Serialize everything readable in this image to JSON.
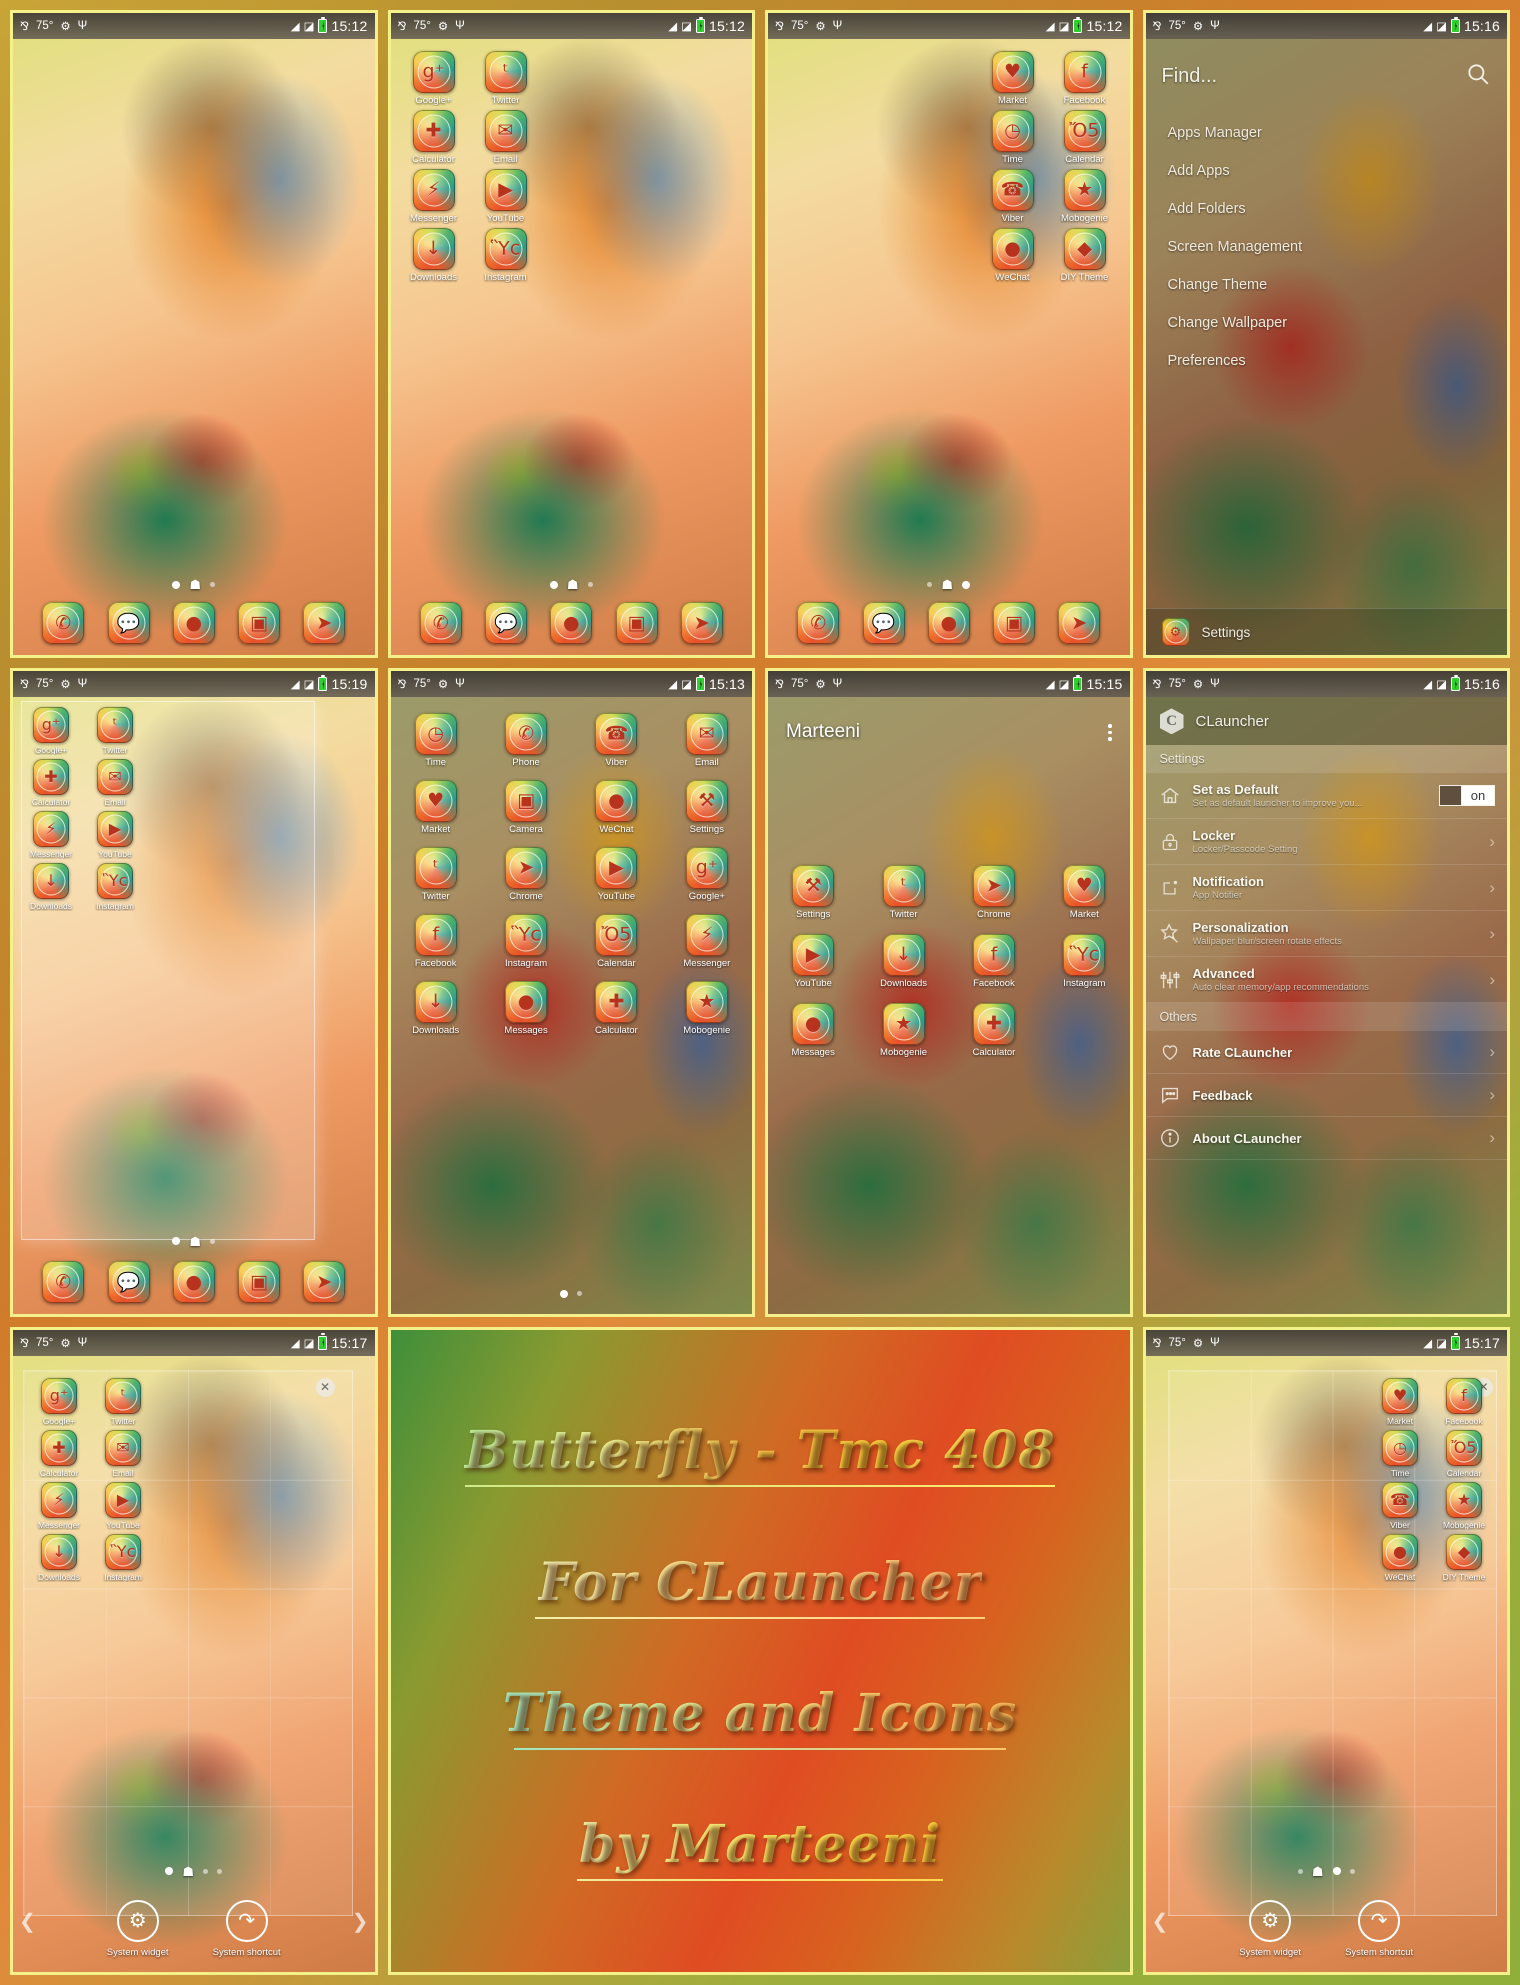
{
  "status_bar": {
    "temperature": "75°",
    "icons": [
      "bluetooth-icon",
      "temperature-icon",
      "android-icon",
      "usb-icon",
      "wifi-icon",
      "signal-icon",
      "battery-charging-icon"
    ],
    "times": {
      "home_main": "15:12",
      "home_left": "15:12",
      "home_right": "15:12",
      "find_menu": "15:16",
      "edit_grid": "15:19",
      "app_drawer": "15:13",
      "folder": "15:15",
      "settings": "15:16",
      "widget_left": "15:17",
      "widget_right": "15:17"
    }
  },
  "dock": {
    "icons": [
      "phone-icon",
      "messages-icon",
      "browser-icon",
      "camera-icon",
      "compass-icon"
    ]
  },
  "panel_home_main": {
    "name": "Home screen - wallpaper only",
    "dots": {
      "active_index": 0,
      "count": 3,
      "home_index": 1
    }
  },
  "panel_home_left": {
    "name": "Home screen left column icons",
    "apps": [
      {
        "label": "Google+",
        "icon": "google-plus-icon",
        "glyph": "g⁺"
      },
      {
        "label": "Twitter",
        "icon": "twitter-icon",
        "glyph": "ᵗ"
      },
      {
        "label": "Calculator",
        "icon": "calculator-icon",
        "glyph": "✚"
      },
      {
        "label": "Email",
        "icon": "email-icon",
        "glyph": "✉"
      },
      {
        "label": "Messenger",
        "icon": "messenger-icon",
        "glyph": "⚡"
      },
      {
        "label": "YouTube",
        "icon": "youtube-icon",
        "glyph": "▶"
      },
      {
        "label": "Downloads",
        "icon": "downloads-icon",
        "glyph": "↓"
      },
      {
        "label": "Instagram",
        "icon": "instagram-icon",
        "glyph": "Ὓc"
      }
    ],
    "dots": {
      "active_index": 0,
      "count": 3,
      "home_index": 1
    }
  },
  "panel_home_right": {
    "name": "Home screen right column icons",
    "apps": [
      {
        "label": "Market",
        "icon": "market-icon",
        "glyph": "♥"
      },
      {
        "label": "Facebook",
        "icon": "facebook-icon",
        "glyph": "f"
      },
      {
        "label": "Time",
        "icon": "time-icon",
        "glyph": "◷"
      },
      {
        "label": "Calendar",
        "icon": "calendar-icon",
        "glyph": "Ὄ5"
      },
      {
        "label": "Viber",
        "icon": "viber-icon",
        "glyph": "☎"
      },
      {
        "label": "Mobogenie",
        "icon": "mobogenie-icon",
        "glyph": "★"
      },
      {
        "label": "WeChat",
        "icon": "wechat-icon",
        "glyph": "●"
      },
      {
        "label": "DIY Theme",
        "icon": "diy-theme-icon",
        "glyph": "◆"
      }
    ],
    "dots": {
      "active_index": 2,
      "count": 3,
      "home_index": 1
    }
  },
  "find_menu": {
    "search_placeholder": "Find...",
    "search_icon": "search-icon",
    "items": [
      "Apps Manager",
      "Add Apps",
      "Add Folders",
      "Screen Management",
      "Change Theme",
      "Change Wallpaper",
      "Preferences"
    ],
    "footer": {
      "label": "Settings",
      "icon": "settings-icon",
      "glyph": "⚒"
    }
  },
  "panel_edit_grid": {
    "name": "Home screen edit / resize grid",
    "apps": [
      {
        "label": "Google+",
        "glyph": "g⁺"
      },
      {
        "label": "Twitter",
        "glyph": "ᵗ"
      },
      {
        "label": "Calculator",
        "glyph": "✚"
      },
      {
        "label": "Email",
        "glyph": "✉"
      },
      {
        "label": "Messenger",
        "glyph": "⚡"
      },
      {
        "label": "YouTube",
        "glyph": "▶"
      },
      {
        "label": "Downloads",
        "glyph": "↓"
      },
      {
        "label": "Instagram",
        "glyph": "Ὓc"
      }
    ],
    "dots": {
      "active_index": 0,
      "count": 3,
      "home_index": 1
    }
  },
  "app_drawer": {
    "name": "All apps drawer",
    "apps": [
      {
        "label": "Time",
        "glyph": "◷"
      },
      {
        "label": "Phone",
        "glyph": "✆"
      },
      {
        "label": "Viber",
        "glyph": "☎"
      },
      {
        "label": "Email",
        "glyph": "✉"
      },
      {
        "label": "Market",
        "glyph": "♥"
      },
      {
        "label": "Camera",
        "glyph": "▣"
      },
      {
        "label": "WeChat",
        "glyph": "●"
      },
      {
        "label": "Settings",
        "glyph": "⚒"
      },
      {
        "label": "Twitter",
        "glyph": "ᵗ"
      },
      {
        "label": "Chrome",
        "glyph": "➤"
      },
      {
        "label": "YouTube",
        "glyph": "▶"
      },
      {
        "label": "Google+",
        "glyph": "g⁺"
      },
      {
        "label": "Facebook",
        "glyph": "f"
      },
      {
        "label": "Instagram",
        "glyph": "Ὓc"
      },
      {
        "label": "Calendar",
        "glyph": "Ὄ5"
      },
      {
        "label": "Messenger",
        "glyph": "⚡"
      },
      {
        "label": "Downloads",
        "glyph": "↓"
      },
      {
        "label": "Messages",
        "glyph": "●"
      },
      {
        "label": "Calculator",
        "glyph": "✚"
      },
      {
        "label": "Mobogenie",
        "glyph": "★"
      }
    ],
    "dots": {
      "active_index": 0,
      "count": 2
    }
  },
  "folder": {
    "name": "Marteeni",
    "menu_icon": "kebab-menu-icon",
    "apps": [
      {
        "label": "Settings",
        "glyph": "⚒"
      },
      {
        "label": "Twitter",
        "glyph": "ᵗ"
      },
      {
        "label": "Chrome",
        "glyph": "➤"
      },
      {
        "label": "Market",
        "glyph": "♥"
      },
      {
        "label": "YouTube",
        "glyph": "▶"
      },
      {
        "label": "Downloads",
        "glyph": "↓"
      },
      {
        "label": "Facebook",
        "glyph": "f"
      },
      {
        "label": "Instagram",
        "glyph": "Ὓc"
      },
      {
        "label": "Messages",
        "glyph": "●"
      },
      {
        "label": "Mobogenie",
        "glyph": "★"
      },
      {
        "label": "Calculator",
        "glyph": "✚"
      }
    ]
  },
  "settings": {
    "app_name": "CLauncher",
    "logo_letter": "C",
    "sections": [
      {
        "header": "Settings",
        "rows": [
          {
            "title": "Set as Default",
            "subtitle": "Set as default launcher to improve you...",
            "icon": "home-icon",
            "control": "toggle",
            "toggle_label": "on",
            "toggle_state": "on"
          },
          {
            "title": "Locker",
            "subtitle": "Locker/Passcode Setting",
            "icon": "lock-icon",
            "control": "chevron"
          },
          {
            "title": "Notification",
            "subtitle": "App Notifier",
            "icon": "notification-icon",
            "control": "chevron"
          },
          {
            "title": "Personalization",
            "subtitle": "Wallpaper blur/screen rotate effects",
            "icon": "magic-star-icon",
            "control": "chevron"
          },
          {
            "title": "Advanced",
            "subtitle": "Auto clear memory/app recommendations",
            "icon": "sliders-icon",
            "control": "chevron"
          }
        ]
      },
      {
        "header": "Others",
        "rows": [
          {
            "title": "Rate CLauncher",
            "subtitle": "",
            "icon": "heart-icon",
            "control": "chevron"
          },
          {
            "title": "Feedback",
            "subtitle": "",
            "icon": "chat-bubble-icon",
            "control": "chevron"
          },
          {
            "title": "About CLauncher",
            "subtitle": "",
            "icon": "info-icon",
            "control": "chevron"
          }
        ]
      }
    ]
  },
  "widget_picker_left": {
    "name": "Widget picker - left screen",
    "apps": [
      {
        "label": "Google+",
        "glyph": "g⁺"
      },
      {
        "label": "Twitter",
        "glyph": "ᵗ"
      },
      {
        "label": "Calculator",
        "glyph": "✚"
      },
      {
        "label": "Email",
        "glyph": "✉"
      },
      {
        "label": "Messenger",
        "glyph": "⚡"
      },
      {
        "label": "YouTube",
        "glyph": "▶"
      },
      {
        "label": "Downloads",
        "glyph": "↓"
      },
      {
        "label": "Instagram",
        "glyph": "Ὓc"
      }
    ],
    "options": [
      {
        "label": "System widget",
        "icon": "gears-icon",
        "glyph": "⚙"
      },
      {
        "label": "System shortcut",
        "icon": "shortcut-arrow-icon",
        "glyph": "↱"
      }
    ],
    "close_icon": "close-icon",
    "prev_icon": "chevron-left-icon",
    "next_icon": "chevron-right-icon",
    "dots": {
      "active_index": 0,
      "count": 3,
      "home_index": 1
    }
  },
  "widget_picker_right": {
    "name": "Widget picker - right screen",
    "apps": [
      {
        "label": "Market",
        "glyph": "♥"
      },
      {
        "label": "Facebook",
        "glyph": "f"
      },
      {
        "label": "Time",
        "glyph": "◷"
      },
      {
        "label": "Calendar",
        "glyph": "Ὄ5"
      },
      {
        "label": "Viber",
        "glyph": "☎"
      },
      {
        "label": "Mobogenie",
        "glyph": "★"
      },
      {
        "label": "WeChat",
        "glyph": "●"
      },
      {
        "label": "DIY Theme",
        "glyph": "◆"
      }
    ],
    "options": [
      {
        "label": "System widget",
        "icon": "gears-icon",
        "glyph": "⚙"
      },
      {
        "label": "System shortcut",
        "icon": "shortcut-arrow-icon",
        "glyph": "↱"
      }
    ],
    "close_icon": "close-icon",
    "prev_icon": "chevron-left-icon",
    "dots": {
      "active_index": 2,
      "count": 3,
      "home_index": 1
    }
  },
  "promo": {
    "lines": [
      "Butterfly - Tmc 408",
      "For CLauncher",
      "Theme and Icons",
      "by Marteeni"
    ]
  },
  "colors": {
    "frame_border": "#f4f08a",
    "accent_orange": "#e05a2c",
    "accent_green": "#4fb26a",
    "battery_green": "#2fd12f"
  }
}
